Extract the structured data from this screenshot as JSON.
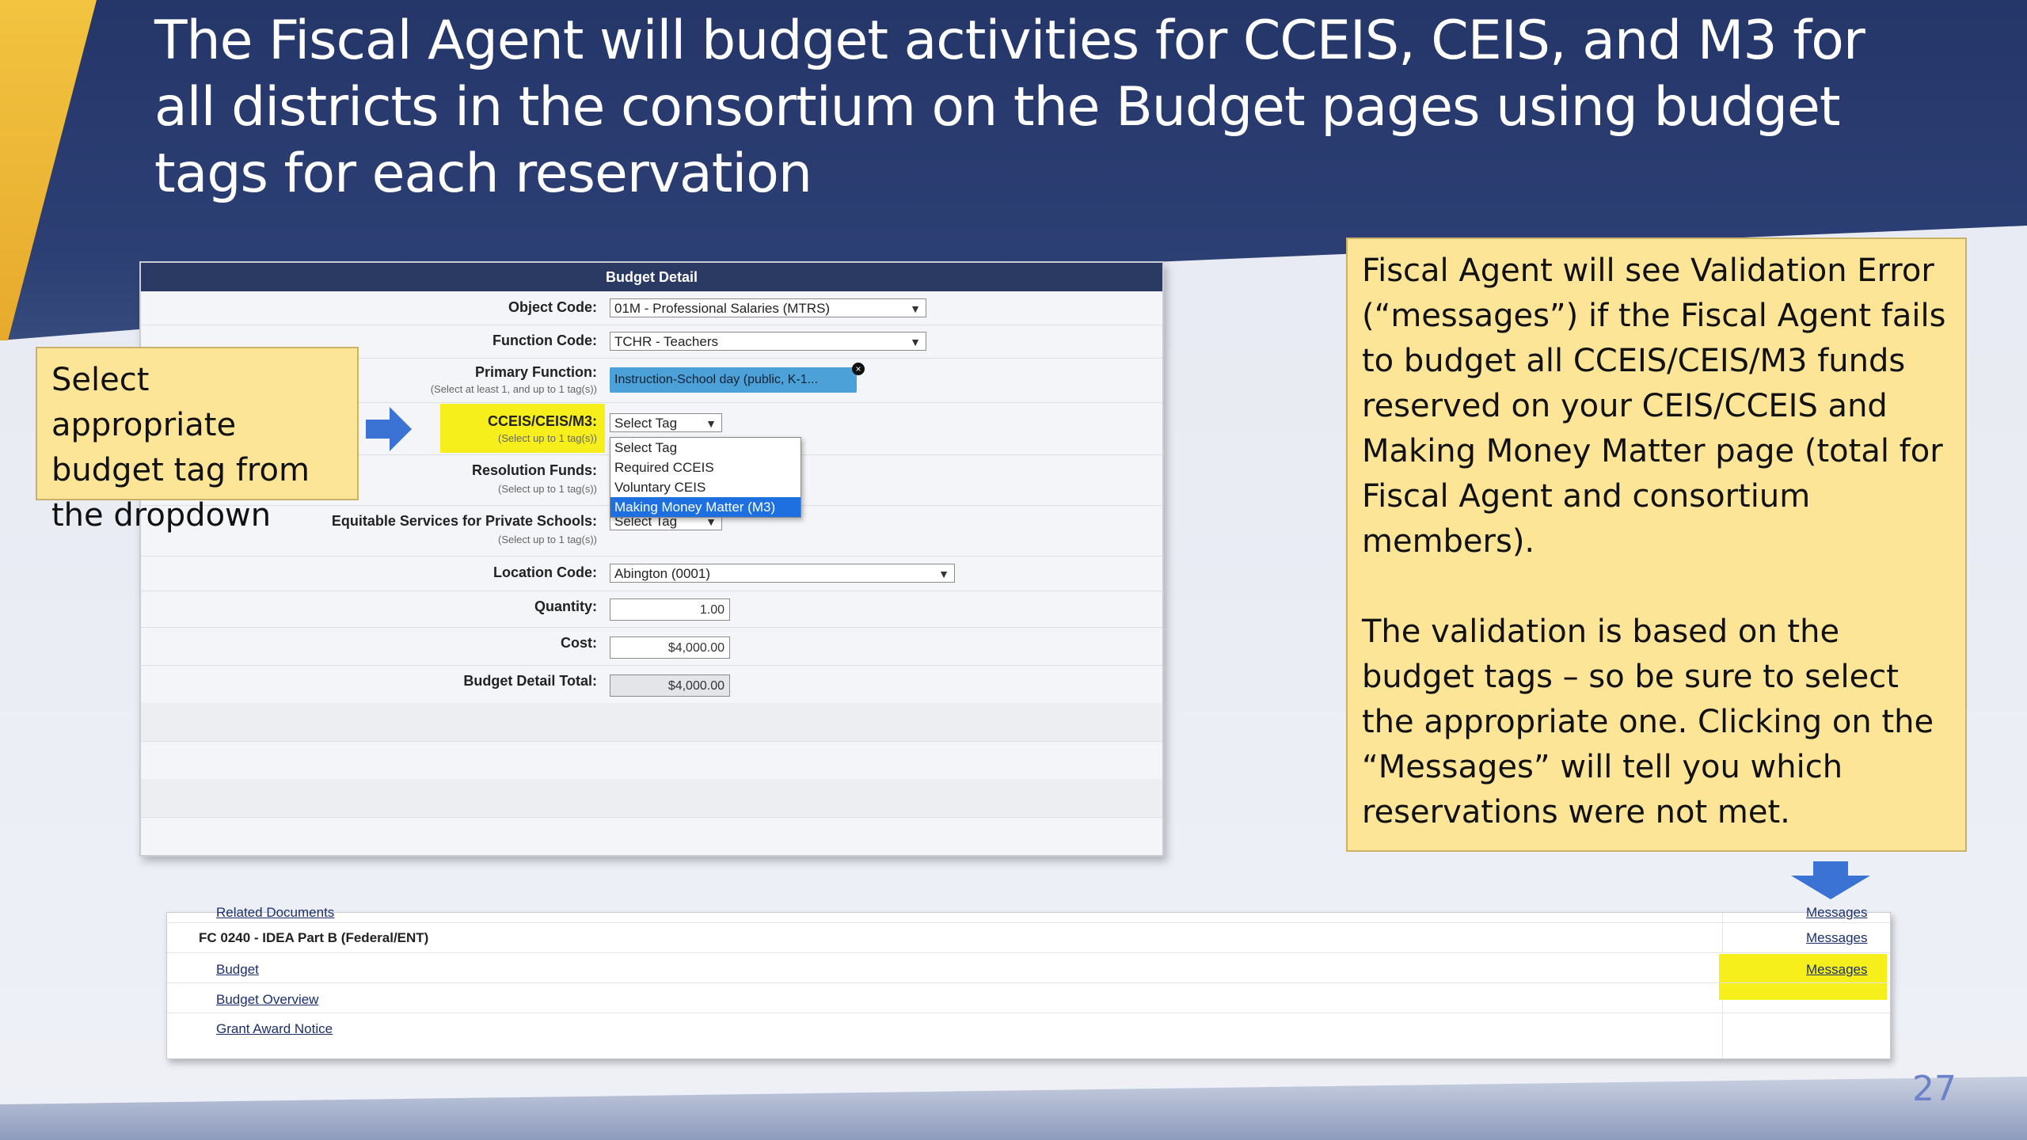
{
  "slide": {
    "title": "The Fiscal Agent will budget activities for CCEIS, CEIS, and M3 for all districts in the consortium on the Budget pages using budget tags for each reservation",
    "page_number": "27"
  },
  "budget_detail": {
    "header": "Budget Detail",
    "object_code": {
      "label": "Object Code:",
      "value": "01M - Professional Salaries (MTRS)"
    },
    "function_code": {
      "label": "Function Code:",
      "value": "TCHR - Teachers"
    },
    "primary_function": {
      "label": "Primary Function:",
      "hint": "(Select at least 1, and up to 1 tag(s))",
      "chip": "Instruction-School day (public, K-1..."
    },
    "cceis": {
      "label": "CCEIS/CEIS/M3:",
      "hint": "(Select up to 1 tag(s))",
      "value": "Select Tag",
      "options": [
        "Select Tag",
        "Required CCEIS",
        "Voluntary CEIS",
        "Making Money Matter (M3)"
      ]
    },
    "resolution_funds": {
      "label": "Resolution Funds:",
      "hint": "(Select up to 1 tag(s))"
    },
    "equitable": {
      "label": "Equitable Services for Private Schools:",
      "hint": "(Select up to 1 tag(s))",
      "value": "Select Tag"
    },
    "location_code": {
      "label": "Location Code:",
      "value": "Abington (0001)"
    },
    "quantity": {
      "label": "Quantity:",
      "value": "1.00"
    },
    "cost": {
      "label": "Cost:",
      "value": "$4,000.00"
    },
    "total": {
      "label": "Budget Detail Total:",
      "value": "$4,000.00"
    }
  },
  "callouts": {
    "left": "Select appropriate budget tag from the dropdown",
    "right_p1": "Fiscal Agent will see Validation Error (“messages”) if the Fiscal Agent fails to budget all CCEIS/CEIS/M3 funds reserved on your CEIS/CCEIS and Making Money Matter page (total for Fiscal Agent and consortium members).",
    "right_p2": "The validation is based on the budget tags – so be sure to select the appropriate one.  Clicking on the “Messages” will tell you which reservations were not met."
  },
  "nav": {
    "related_documents": "Related Documents",
    "fund_title": "FC 0240 - IDEA Part B (Federal/ENT)",
    "budget": "Budget",
    "budget_overview": "Budget Overview",
    "grant_award_notice": "Grant Award Notice",
    "messages": "Messages"
  },
  "colors": {
    "highlight": "#f7ef1b",
    "callout_bg": "#fde598",
    "header_navy": "#2b3a63",
    "arrow_blue": "#3a73d4"
  }
}
